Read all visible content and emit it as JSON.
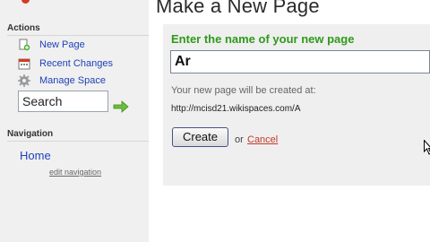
{
  "sidebar": {
    "actions_heading": "Actions",
    "items": [
      {
        "label": "New Page",
        "icon": "new-page-icon"
      },
      {
        "label": "Recent Changes",
        "icon": "calendar-icon"
      },
      {
        "label": "Manage Space",
        "icon": "gear-icon"
      }
    ],
    "search": {
      "value": "Search",
      "go_icon": "arrow-right-icon"
    },
    "navigation_heading": "Navigation",
    "home_label": "Home",
    "edit_navigation_label": "edit navigation"
  },
  "main": {
    "title": "Make a New Page",
    "prompt": "Enter the name of your new page",
    "page_name_value": "Ar",
    "created_at_label": "Your new page will be created at:",
    "url": "http://mcisd21.wikispaces.com/A",
    "create_button": "Create",
    "or_text": "or",
    "cancel_link": "Cancel"
  },
  "colors": {
    "link": "#1f42b8",
    "prompt_green": "#2f9a1a",
    "cancel_red": "#c0392b",
    "sidebar_bg": "#f0f0f0",
    "panel_bg": "#efefef"
  }
}
